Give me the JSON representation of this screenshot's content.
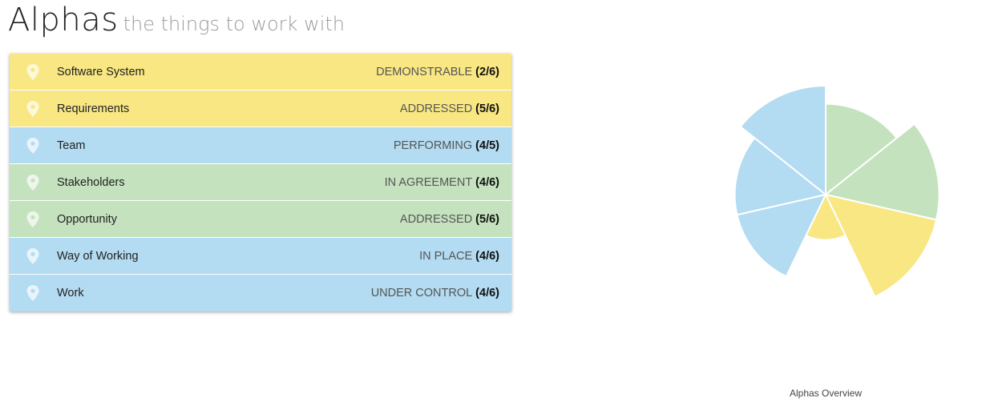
{
  "header": {
    "title": "Alphas",
    "subtitle": "the things to work with"
  },
  "colors": {
    "yellow": "#f8e782",
    "blue": "#b3dbf1",
    "green": "#c5e2bf"
  },
  "alphas": [
    {
      "name": "Software System",
      "state": "DEMONSTRABLE",
      "progress": "(2/6)",
      "color": "yellow",
      "current": 2,
      "total": 6
    },
    {
      "name": "Requirements",
      "state": "ADDRESSED",
      "progress": "(5/6)",
      "color": "yellow",
      "current": 5,
      "total": 6
    },
    {
      "name": "Team",
      "state": "PERFORMING",
      "progress": "(4/5)",
      "color": "blue",
      "current": 4,
      "total": 5
    },
    {
      "name": "Stakeholders",
      "state": "IN AGREEMENT",
      "progress": "(4/6)",
      "color": "green",
      "current": 4,
      "total": 6
    },
    {
      "name": "Opportunity",
      "state": "ADDRESSED",
      "progress": "(5/6)",
      "color": "green",
      "current": 5,
      "total": 6
    },
    {
      "name": "Way of Working",
      "state": "IN PLACE",
      "progress": "(4/6)",
      "color": "blue",
      "current": 4,
      "total": 6
    },
    {
      "name": "Work",
      "state": "UNDER CONTROL",
      "progress": "(4/6)",
      "color": "blue",
      "current": 4,
      "total": 6
    }
  ],
  "chart": {
    "caption": "Alphas Overview"
  },
  "chart_data": {
    "type": "pie",
    "title": "",
    "slices": [
      {
        "label": "Stakeholders",
        "fraction": 0.667,
        "color": "green"
      },
      {
        "label": "Opportunity",
        "fraction": 0.833,
        "color": "green"
      },
      {
        "label": "Requirements",
        "fraction": 0.833,
        "color": "yellow"
      },
      {
        "label": "Software System",
        "fraction": 0.333,
        "color": "yellow"
      },
      {
        "label": "Work",
        "fraction": 0.667,
        "color": "blue"
      },
      {
        "label": "Way of Working",
        "fraction": 0.667,
        "color": "blue"
      },
      {
        "label": "Team",
        "fraction": 0.8,
        "color": "blue"
      }
    ]
  }
}
